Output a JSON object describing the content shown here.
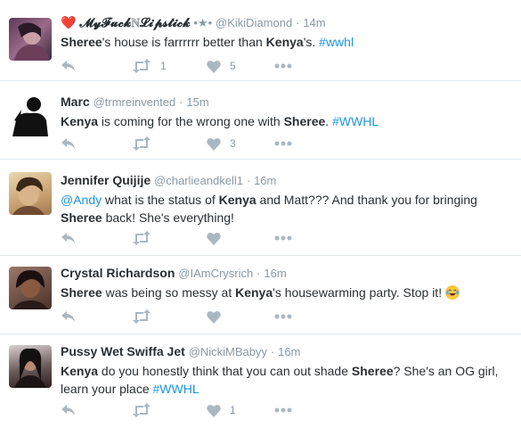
{
  "tweets": [
    {
      "name_prefix": "❤️",
      "name": "𝓜𝔂𝓕𝓾𝓬𝓴ℕ𝓛𝓲𝓹𝓼𝓽𝓲𝓬𝓴",
      "name_suffix": "•★•",
      "handle": "@KikiDiamond",
      "time": "14m",
      "text_parts": [
        "Sheree",
        "'s house is farrrrrr better than ",
        "Kenya",
        "'s. ",
        "#wwhl"
      ],
      "retweets": "1",
      "likes": "5"
    },
    {
      "name": "Marc",
      "handle": "@trmreinvented",
      "time": "15m",
      "text_parts": [
        "Kenya",
        " is coming for the wrong one with ",
        "Sheree",
        ". ",
        "#WWHL"
      ],
      "retweets": "",
      "likes": "3"
    },
    {
      "name": "Jennifer Quijije",
      "handle": "@charlieandkell1",
      "time": "16m",
      "text_parts": [
        "@Andy",
        " what is the status of ",
        "Kenya",
        " and Matt??? And thank you for bringing ",
        "Sheree",
        " back! She's everything!"
      ],
      "retweets": "",
      "likes": ""
    },
    {
      "name": "Crystal Richardson",
      "handle": "@IAmCrysrich",
      "time": "16m",
      "text_parts": [
        "Sheree",
        " was being so messy at ",
        "Kenya",
        "'s housewarming party. Stop it! "
      ],
      "retweets": "",
      "likes": ""
    },
    {
      "name": "Pussy Wet Swiffa Jet",
      "handle": "@NickiMBabyy",
      "time": "16m",
      "text_parts": [
        "Kenya",
        " do you honestly think that you can out shade ",
        "Sheree",
        "? She's an OG girl, learn your place ",
        "#WWHL"
      ],
      "retweets": "",
      "likes": "1"
    }
  ],
  "separator": "·",
  "icons": {
    "reply": "reply-icon",
    "retweet": "retweet-icon",
    "like": "heart-icon",
    "more": "more-icon",
    "emoji": "tears-of-joy-emoji"
  },
  "colors": {
    "link": "#1b95e0",
    "muted": "#8899a6",
    "action_icon": "#aab8c2",
    "divider": "#e1e8ed"
  }
}
